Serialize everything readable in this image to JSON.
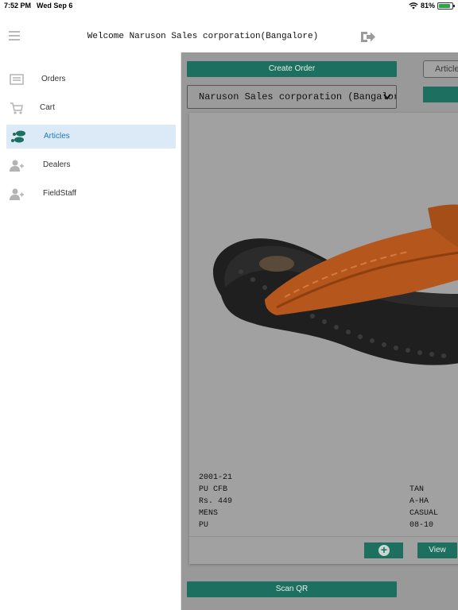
{
  "status_bar": {
    "time": "7:52 PM",
    "date": "Wed Sep 6",
    "battery": "81%"
  },
  "header": {
    "title": "Welcome Naruson Sales corporation(Bangalore)"
  },
  "drawer": {
    "items": [
      {
        "label": "Orders",
        "icon": "orders-list-icon",
        "active": false
      },
      {
        "label": "Cart",
        "icon": "cart-icon",
        "active": false
      },
      {
        "label": "Articles",
        "icon": "footprints-icon",
        "active": true
      },
      {
        "label": "Dealers",
        "icon": "add-user-icon",
        "active": false
      },
      {
        "label": "FieldStaff",
        "icon": "add-user-icon",
        "active": false
      }
    ]
  },
  "main": {
    "create_order_label": "Create Order",
    "dealer_select_value": "Naruson Sales corporation (Bangalore)",
    "articles_tab_label": "Articles",
    "scan_qr_label": "Scan QR",
    "product": {
      "code": "2001-21",
      "material": "PU CFB",
      "price": "Rs. 449",
      "gender": "MENS",
      "sole": "PU",
      "color": "TAN",
      "category": "A-HA",
      "style": "CASUAL",
      "size_range": "08-10",
      "view_label": "View"
    }
  },
  "colors": {
    "accent": "#1d6f60",
    "active_item_bg": "#dceaf7",
    "active_item_text": "#1e7ab8",
    "overlay": "#999999"
  }
}
